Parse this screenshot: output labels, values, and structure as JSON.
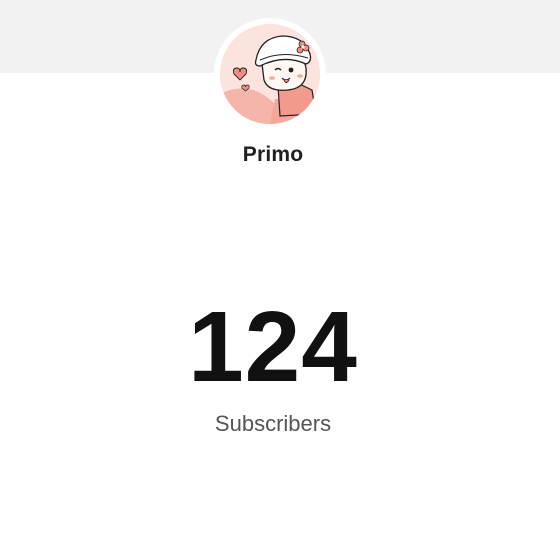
{
  "channel": {
    "name": "Primo",
    "avatar_icon": "cartoon-character-avatar-icon"
  },
  "stats": {
    "subscriber_count": "124",
    "subscriber_label": "Subscribers"
  },
  "colors": {
    "top_band": "#f2f2f2",
    "avatar_bg": "#fde3dd",
    "accent_pink": "#f08c80",
    "count_text": "#111111",
    "label_text": "#555555"
  }
}
